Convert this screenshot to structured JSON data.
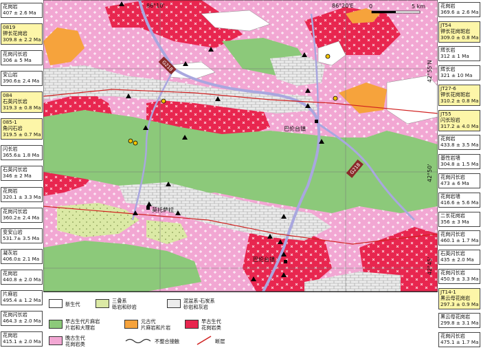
{
  "left_labels": [
    {
      "rock": "花岗岩",
      "age": "407 ± 2.6 Ma",
      "hl": false
    },
    {
      "rock": "0819",
      "rock2": "钾长花岗岩",
      "age": "309.8 ± 2.2 Ma",
      "hl": true
    },
    {
      "rock": "花岗闪长岩",
      "age": "306 ± 5 Ma",
      "hl": false
    },
    {
      "rock": "安山岩",
      "age": "390.6± 2.4 Ma",
      "hl": false
    },
    {
      "rock": "084",
      "rock2": "石英闪长岩",
      "age": "319.3 ± 0.8 Ma",
      "hl": true
    },
    {
      "rock": "085-1",
      "rock2": "角闪石岩",
      "age": "319.5 ± 0.7 Ma",
      "hl": true
    },
    {
      "rock": "闪长岩",
      "age": "365.6± 1.8 Ma",
      "hl": false
    },
    {
      "rock": "石英闪长岩",
      "age": "346 ± 2 Ma",
      "hl": false
    },
    {
      "rock": "花岗岩",
      "age": "320.1 ± 3.3 Ma",
      "hl": false
    },
    {
      "rock": "花岗闪长岩",
      "age": "360.2± 2.4 Ma",
      "hl": false
    },
    {
      "rock": "变安山岩",
      "age": "531.7± 3.5 Ma",
      "hl": false
    },
    {
      "rock": "凝灰岩",
      "age": "406.0± 2.1 Ma",
      "hl": false
    },
    {
      "rock": "花岗岩",
      "age": "440.8 ± 2.0 Ma",
      "hl": false
    },
    {
      "rock": "片麻岩",
      "age": "495.4 ± 1.2 Ma",
      "hl": false
    },
    {
      "rock": "花岗闪长岩",
      "age": "464.3 ± 2.0 Ma",
      "hl": false
    },
    {
      "rock": "花岗岩",
      "age": "415.1 ± 2.0 Ma",
      "hl": false
    }
  ],
  "right_labels": [
    {
      "rock": "花岗岩",
      "age": "369.6 ± 2.6 Ma",
      "hl": false
    },
    {
      "rock": "JT54",
      "rock2": "钾长花岗斑岩",
      "age": "309.0 ± 0.8 Ma",
      "hl": true
    },
    {
      "rock": "辉长岩",
      "age": "312 ± 1 Ma",
      "hl": false
    },
    {
      "rock": "辉长岩",
      "age": "321 ± 10 Ma",
      "hl": false
    },
    {
      "rock": "JT27-6",
      "rock2": "钾长花岗斑岩",
      "age": "310.2 ± 0.8 Ma",
      "hl": true
    },
    {
      "rock": "JT55",
      "rock2": "闪长玢岩",
      "age": "317.2 ± 4.0 Ma",
      "hl": true
    },
    {
      "rock": "花岗岩",
      "age": "433.8 ± 3.5 Ma",
      "hl": false
    },
    {
      "rock": "基性岩墙",
      "age": "304.8 ± 1.5 Ma",
      "hl": false
    },
    {
      "rock": "花岗闪长岩",
      "age": "473 ± 6 Ma",
      "hl": false
    },
    {
      "rock": "花岗岩墙",
      "age": "416.6 ± 5.6 Ma",
      "hl": false
    },
    {
      "rock": "二长花岗岩",
      "age": "356 ± 3 Ma",
      "hl": false
    },
    {
      "rock": "花岗闪长岩",
      "age": "460.1 ± 1.7 Ma",
      "hl": false
    },
    {
      "rock": "石英闪长岩",
      "age": "435 ± 2.0 Ma",
      "hl": false
    },
    {
      "rock": "花岗闪长岩",
      "age": "450.9 ± 3.3 Ma",
      "hl": false
    },
    {
      "rock": "JT14-1",
      "rock2": "黑云母花岗岩",
      "age": "297.3 ± 0.9 Ma",
      "hl": true
    },
    {
      "rock": "黑云母花岗岩",
      "age": "299.8 ± 3.1 Ma",
      "hl": false
    },
    {
      "rock": "花岗闪长岩",
      "age": "475.1 ± 1.7 Ma",
      "hl": false
    }
  ],
  "map": {
    "lon_1": "86°10'",
    "lon_2": "86°20'E",
    "lat_1": "42°55'N",
    "lat_2": "42°50'",
    "lat_3": "42°45'",
    "scale_0": "0",
    "scale_5": "5 km",
    "road_1": "G218",
    "road_2": "G218",
    "town_1": "巴伦台镇",
    "town_2": "莫托萨拉",
    "town_3": "巴伦台镇"
  },
  "legend": {
    "cenozoic": "新生代",
    "triassic": "三叠系",
    "triassic_sub": "砾岩和砂岩",
    "devonian": "泥盆系-石炭系",
    "devonian_sub": "砂岩和灰岩",
    "early_paleo_schist": "早古生代片麻岩",
    "early_paleo_schist_sub": "片岩和大理岩",
    "proterozoic": "元古代",
    "proterozoic_sub": "片麻岩和片岩",
    "early_paleo_granite": "早古生代",
    "early_paleo_granite_sub": "花岗岩类",
    "late_paleo_granite": "晚古生代",
    "late_paleo_granite_sub": "花岗岩类",
    "unconformity": "不整合接触",
    "fault": "断层"
  },
  "colors": {
    "late_granite": "#f2a7d3",
    "early_granite": "#e8264f",
    "early_schist": "#8cc97a",
    "triassic": "#dbe9a5",
    "devonian": "#e9e9e9",
    "proterozoic": "#f6a33c",
    "cenozoic": "#ffffff",
    "river": "#a9a7df"
  }
}
